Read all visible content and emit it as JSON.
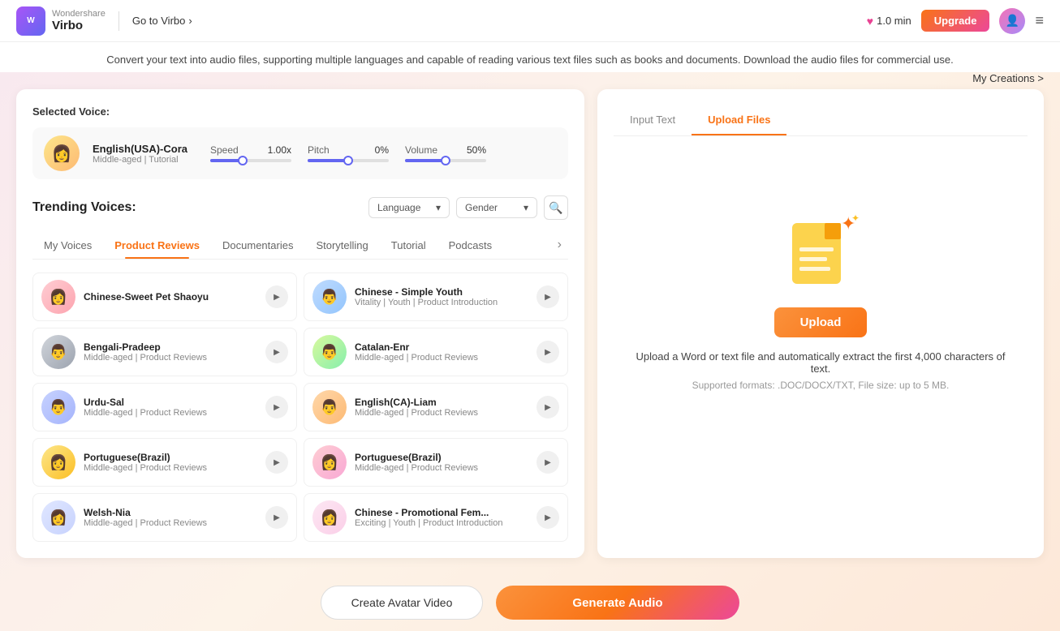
{
  "header": {
    "brand": "Wondershare",
    "product": "Virbo",
    "go_to_virbo": "Go to Virbo",
    "credits": "1.0 min",
    "upgrade_label": "Upgrade",
    "menu_icon": "≡"
  },
  "banner": {
    "text": "Convert your text into audio files, supporting multiple languages and capable of reading various text files such as books and documents. Download the audio files for commercial use.",
    "my_creations_link": "My Creations >"
  },
  "selected_voice": {
    "label": "Selected Voice:",
    "name": "English(USA)-Cora",
    "meta": "Middle-aged | Tutorial",
    "speed_label": "Speed",
    "speed_value": "1.00x",
    "pitch_label": "Pitch",
    "pitch_value": "0%",
    "volume_label": "Volume",
    "volume_value": "50%"
  },
  "trending": {
    "title": "Trending Voices:",
    "language_placeholder": "Language",
    "gender_placeholder": "Gender",
    "tabs": [
      {
        "id": "my-voices",
        "label": "My Voices",
        "active": false
      },
      {
        "id": "product-reviews",
        "label": "Product Reviews",
        "active": true
      },
      {
        "id": "documentaries",
        "label": "Documentaries",
        "active": false
      },
      {
        "id": "storytelling",
        "label": "Storytelling",
        "active": false
      },
      {
        "id": "tutorial",
        "label": "Tutorial",
        "active": false
      },
      {
        "id": "podcasts",
        "label": "Podcasts",
        "active": false
      }
    ],
    "voices": [
      {
        "id": 1,
        "name": "Chinese-Sweet Pet Shaoyu",
        "tags": ""
      },
      {
        "id": 2,
        "name": "Chinese - Simple Youth",
        "tags": "Vitality | Youth | Product Introduction"
      },
      {
        "id": 3,
        "name": "Bengali-Pradeep",
        "tags": "Middle-aged | Product Reviews"
      },
      {
        "id": 4,
        "name": "Catalan-Enr",
        "tags": "Middle-aged | Product Reviews"
      },
      {
        "id": 5,
        "name": "Urdu-Sal",
        "tags": "Middle-aged | Product Reviews"
      },
      {
        "id": 6,
        "name": "English(CA)-Liam",
        "tags": "Middle-aged | Product Reviews"
      },
      {
        "id": 7,
        "name": "Portuguese(Brazil)",
        "tags": "Middle-aged | Product Reviews"
      },
      {
        "id": 8,
        "name": "Portuguese(Brazil)",
        "tags": "Middle-aged | Product Reviews"
      },
      {
        "id": 9,
        "name": "Welsh-Nia",
        "tags": "Middle-aged | Product Reviews"
      },
      {
        "id": 10,
        "name": "Chinese - Promotional Fem...",
        "tags": "Exciting | Youth | Product Introduction"
      }
    ]
  },
  "right_panel": {
    "tab_input_text": "Input Text",
    "tab_upload_files": "Upload Files",
    "active_tab": "upload",
    "upload_button_label": "Upload",
    "upload_desc": "Upload a Word or text file and automatically extract the first 4,000 characters of text.",
    "upload_formats": "Supported formats: .DOC/DOCX/TXT, File size: up to 5 MB."
  },
  "bottom_bar": {
    "create_avatar_label": "Create Avatar Video",
    "generate_audio_label": "Generate Audio"
  }
}
